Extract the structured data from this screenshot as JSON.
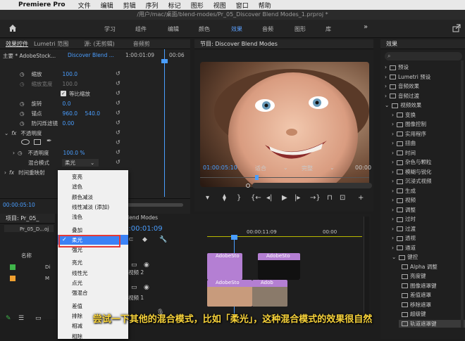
{
  "menubar": {
    "app": "Premiere Pro",
    "items": [
      "文件",
      "编辑",
      "剪辑",
      "序列",
      "标记",
      "图形",
      "视图",
      "窗口",
      "帮助"
    ]
  },
  "path": "/用户/mac/桌面/blend-modes/Pr_05_Discover Blend Modes_1.prproj *",
  "workspaces": [
    {
      "label": "学习",
      "active": false
    },
    {
      "label": "组件",
      "active": false
    },
    {
      "label": "编辑",
      "active": false
    },
    {
      "label": "颜色",
      "active": false
    },
    {
      "label": "效果",
      "active": true
    },
    {
      "label": "音频",
      "active": false
    },
    {
      "label": "图形",
      "active": false
    },
    {
      "label": "库",
      "active": false
    }
  ],
  "effect_controls": {
    "tabs": [
      "效果控件",
      "Lumetri 范围",
      "源: (无剪辑)",
      "音频剪"
    ],
    "source": "主要 * AdobeStock...",
    "sequence": "Discover Blend ...",
    "timecode_start": "1:00:01:09",
    "timecode_end": "00:06",
    "rows": [
      {
        "label": "缩放",
        "value": "100.0"
      },
      {
        "label": "缩放宽度",
        "value": "100.0"
      },
      {
        "label": "等比缩放",
        "value": ""
      },
      {
        "label": "旋转",
        "value": "0.0"
      },
      {
        "label": "锚点",
        "value": "960.0",
        "value2": "540.0"
      },
      {
        "label": "防闪烁滤镜",
        "value": "0.00"
      },
      {
        "label": "不透明度",
        "value": ""
      },
      {
        "label": "不透明度",
        "value": "100.0 %"
      },
      {
        "label": "混合模式",
        "value": "柔光"
      },
      {
        "label": "时间重映射",
        "value": ""
      }
    ],
    "bottom_timecode": "00:00:05:10"
  },
  "program_monitor": {
    "title": "节目: Discover Blend Modes",
    "timecode": "01:00:05:10",
    "fit": "适合",
    "quality": "完整",
    "end_timecode": "00:00"
  },
  "dropdown": {
    "items": [
      "变亮",
      "滤色",
      "颜色减淡",
      "线性减淡 (添加)",
      "浅色",
      "叠加",
      "柔光",
      "强光",
      "亮光",
      "线性光",
      "点光",
      "强混合",
      "差值",
      "排除",
      "相减",
      "相除"
    ],
    "selected_index": 6
  },
  "project": {
    "title": "项目: Pr_05_",
    "file": "Pr_05_D...oj",
    "name_header": "名称",
    "items": [
      "Di",
      "M"
    ]
  },
  "timeline": {
    "title": "Blend Modes",
    "timecode": "1:00:01:09",
    "ruler_time": "00:00:11:09",
    "ruler_time2": "00:00",
    "tracks": [
      "视频 2",
      "视频 1"
    ],
    "clips": {
      "v2a": "AdobeSto",
      "v2b": "AdobeSto",
      "v1a": "AdobeSto",
      "v1b": "Adob"
    }
  },
  "effects_panel": {
    "title": "效果",
    "items": [
      {
        "label": "预设",
        "level": 0,
        "open": false
      },
      {
        "label": "Lumetri 预设",
        "level": 0,
        "open": false
      },
      {
        "label": "音频效果",
        "level": 0,
        "open": false
      },
      {
        "label": "音频过渡",
        "level": 0,
        "open": false
      },
      {
        "label": "视频效果",
        "level": 0,
        "open": true
      },
      {
        "label": "变换",
        "level": 1,
        "open": false
      },
      {
        "label": "图像控制",
        "level": 1,
        "open": false
      },
      {
        "label": "实用程序",
        "level": 1,
        "open": false
      },
      {
        "label": "扭曲",
        "level": 1,
        "open": false
      },
      {
        "label": "时间",
        "level": 1,
        "open": false
      },
      {
        "label": "杂色与颗粒",
        "level": 1,
        "open": false
      },
      {
        "label": "模糊与锐化",
        "level": 1,
        "open": false
      },
      {
        "label": "沉浸式视频",
        "level": 1,
        "open": false
      },
      {
        "label": "生成",
        "level": 1,
        "open": false
      },
      {
        "label": "视频",
        "level": 1,
        "open": false
      },
      {
        "label": "调整",
        "level": 1,
        "open": false
      },
      {
        "label": "过时",
        "level": 1,
        "open": false
      },
      {
        "label": "过渡",
        "level": 1,
        "open": false
      },
      {
        "label": "透视",
        "level": 1,
        "open": false
      },
      {
        "label": "通道",
        "level": 1,
        "open": false
      },
      {
        "label": "键控",
        "level": 1,
        "open": true
      },
      {
        "label": "Alpha 调整",
        "level": 2,
        "open": false
      },
      {
        "label": "亮度键",
        "level": 2,
        "open": false
      },
      {
        "label": "图像遮罩键",
        "level": 2,
        "open": false
      },
      {
        "label": "差值遮罩",
        "level": 2,
        "open": false
      },
      {
        "label": "移除遮罩",
        "level": 2,
        "open": false
      },
      {
        "label": "超级键",
        "level": 2,
        "open": false
      },
      {
        "label": "轨道遮罩键",
        "level": 2,
        "open": false
      }
    ]
  },
  "subtitle": "尝试一下其他的混合模式，比如「柔光」，这种混合模式的效果很自然"
}
